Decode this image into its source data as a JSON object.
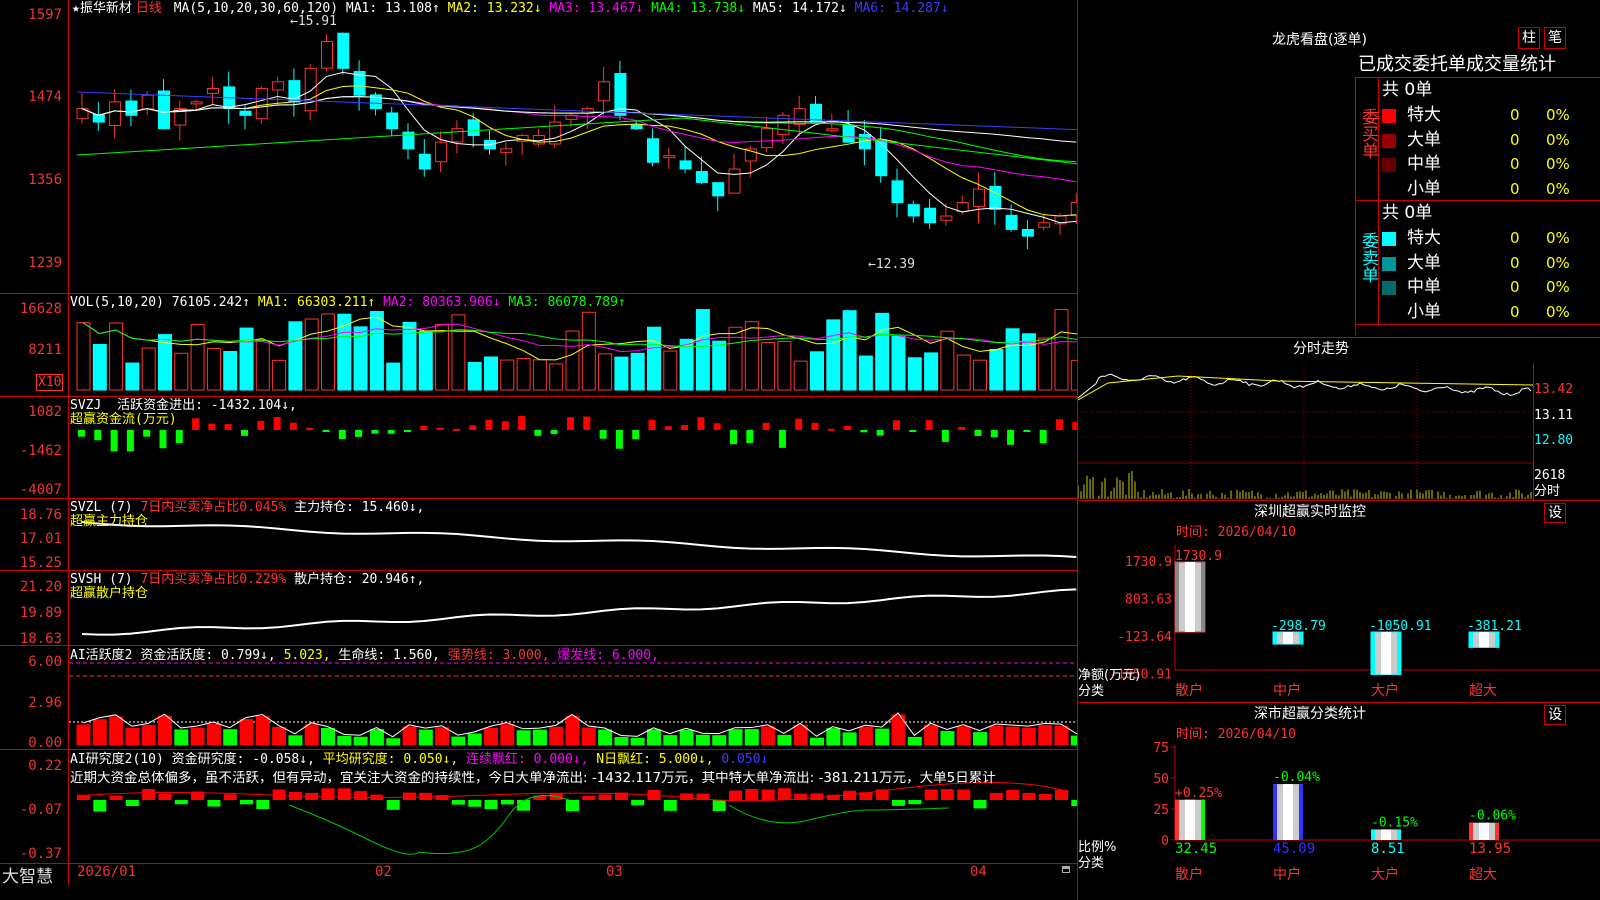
{
  "app": {
    "name": "大智慧"
  },
  "stock": {
    "star": "★",
    "name": "振华新材",
    "period": "日线"
  },
  "colors": {
    "up": "#ff3232",
    "down": "#00ffff",
    "grid": "#8b0000"
  },
  "ma_header": {
    "label": "MA(5,10,20,30,60,120)",
    "items": [
      {
        "text": "MA1: 13.108↑",
        "color": "#ffffff"
      },
      {
        "text": "MA2: 13.232↓",
        "color": "#ffff00"
      },
      {
        "text": "MA3: 13.467↓",
        "color": "#ff00ff"
      },
      {
        "text": "MA4: 13.738↓",
        "color": "#00ff00"
      },
      {
        "text": "MA5: 14.172↓",
        "color": "#ffffff"
      },
      {
        "text": "MA6: 14.287↓",
        "color": "#3c3cff"
      }
    ]
  },
  "price_axis": [
    "1597",
    "1474",
    "1356",
    "1239"
  ],
  "price_marks": {
    "high": "15.91",
    "low": "12.39"
  },
  "vol_header": {
    "label": "VOL(5,10,20)",
    "value": "76105.242↑",
    "items": [
      {
        "text": "MA1: 66303.211↑",
        "color": "#ffff00"
      },
      {
        "text": "MA2: 80363.906↓",
        "color": "#ff00ff"
      },
      {
        "text": "MA3: 86078.789↑",
        "color": "#00ff00"
      }
    ]
  },
  "vol_axis": [
    "16628",
    "8211"
  ],
  "vol_unit": "X10",
  "svzj": {
    "label": "SVZJ",
    "title": "活跃资金进出: -1432.104↓,",
    "sub": "超赢资金流(万元)",
    "axis": [
      "1082",
      "-1462",
      "-4007"
    ]
  },
  "svzl": {
    "label": "SVZL (7)",
    "ratio": "7日内买卖净占比0.045%",
    "hold": "主力持仓: 15.460↓,",
    "sub": "超赢主力持仓",
    "axis": [
      "18.76",
      "17.01",
      "15.25"
    ]
  },
  "svsh": {
    "label": "SVSH (7)",
    "ratio": "7日内买卖净占比0.229%",
    "hold": "散户持仓: 20.946↑,",
    "sub": "超赢散户持仓",
    "axis": [
      "21.20",
      "19.89",
      "18.63"
    ]
  },
  "ai_active": {
    "label": "AI活跃度2",
    "items": [
      {
        "text": "资金活跃度: 0.799↓,",
        "color": "#ffffff"
      },
      {
        "text": "5.023,",
        "color": "#ffff00"
      },
      {
        "text": "生命线: 1.560,",
        "color": "#ffffff"
      },
      {
        "text": "强势线: 3.000,",
        "color": "#ff3232"
      },
      {
        "text": "爆发线: 6.000,",
        "color": "#ff00ff"
      }
    ],
    "axis": [
      "6.00",
      "2.96",
      "0.00"
    ]
  },
  "ai_research": {
    "label": "AI研究度2(10)",
    "items": [
      {
        "text": "资金研究度: -0.058↓,",
        "color": "#ffffff"
      },
      {
        "text": "平均研究度: 0.050↓,",
        "color": "#ffff00"
      },
      {
        "text": "连续飘红: 0.000↓,",
        "color": "#ff00ff"
      },
      {
        "text": "N日飘红: 5.000↓,",
        "color": "#ffff00"
      },
      {
        "text": "0.050↓",
        "color": "#3c3cff"
      }
    ],
    "comment": "近期大资金总体偏多，虽不活跃，但有异动，宜关注大资金的持续性，今日大单净流出: -1432.117万元，其中特大单净流出: -381.211万元，大单5日累计",
    "axis": [
      "0.22",
      "-0.07",
      "-0.37"
    ]
  },
  "date_axis": [
    "2026/01",
    "02",
    "03",
    "04"
  ],
  "dragon": {
    "title": "龙虎看盘(逐单)",
    "btn1": "柱",
    "btn2": "笔",
    "tabs": "已成交委托单成交量统计",
    "buy": {
      "side": "委买单",
      "total": "共 0单",
      "rows": [
        {
          "label": "特大",
          "v": "0",
          "p": "0%",
          "color": "#ff0000"
        },
        {
          "label": "大单",
          "v": "0",
          "p": "0%",
          "color": "#990000"
        },
        {
          "label": "中单",
          "v": "0",
          "p": "0%",
          "color": "#660000"
        },
        {
          "label": "小单",
          "v": "0",
          "p": "0%",
          "color": ""
        }
      ]
    },
    "sell": {
      "side": "委卖单",
      "total": "共 0单",
      "rows": [
        {
          "label": "特大",
          "v": "0",
          "p": "0%",
          "color": "#00ffff"
        },
        {
          "label": "大单",
          "v": "0",
          "p": "0%",
          "color": "#009999"
        },
        {
          "label": "中单",
          "v": "0",
          "p": "0%",
          "color": "#006b6b"
        },
        {
          "label": "小单",
          "v": "0",
          "p": "0%",
          "color": ""
        }
      ]
    }
  },
  "minute": {
    "title": "分时走势",
    "axis": [
      "13.42",
      "13.11",
      "12.80",
      "2618",
      "分时"
    ]
  },
  "sz_monitor": {
    "title": "深圳超赢实时监控",
    "set": "设",
    "time": "时间: 2026/04/10",
    "ylabel": "净额(万元)",
    "xlabel": "分类",
    "axis": [
      "1730.9",
      "803.63",
      "-123.64",
      "-1050.91"
    ],
    "bars": [
      {
        "cat": "散户",
        "value": 1730.9,
        "label": "1730.9"
      },
      {
        "cat": "中户",
        "value": -298.79,
        "label": "-298.79"
      },
      {
        "cat": "大户",
        "value": -1050.91,
        "label": "-1050.91"
      },
      {
        "cat": "超大",
        "value": -381.21,
        "label": "-381.21"
      }
    ]
  },
  "sz_class": {
    "title": "深市超赢分类统计",
    "set": "设",
    "time": "时间: 2026/04/10",
    "ylabel": "比例%",
    "xlabel": "分类",
    "axis": [
      "75",
      "50",
      "25",
      "0"
    ],
    "bars": [
      {
        "cat": "散户",
        "value": 32.45,
        "label": "32.45",
        "chg": "+0.25%"
      },
      {
        "cat": "中户",
        "value": 45.09,
        "label": "45.09",
        "chg": "-0.04%"
      },
      {
        "cat": "大户",
        "value": 8.51,
        "label": "8.51",
        "chg": "-0.15%"
      },
      {
        "cat": "超大",
        "value": 13.95,
        "label": "13.95",
        "chg": "-0.06%"
      }
    ]
  }
}
